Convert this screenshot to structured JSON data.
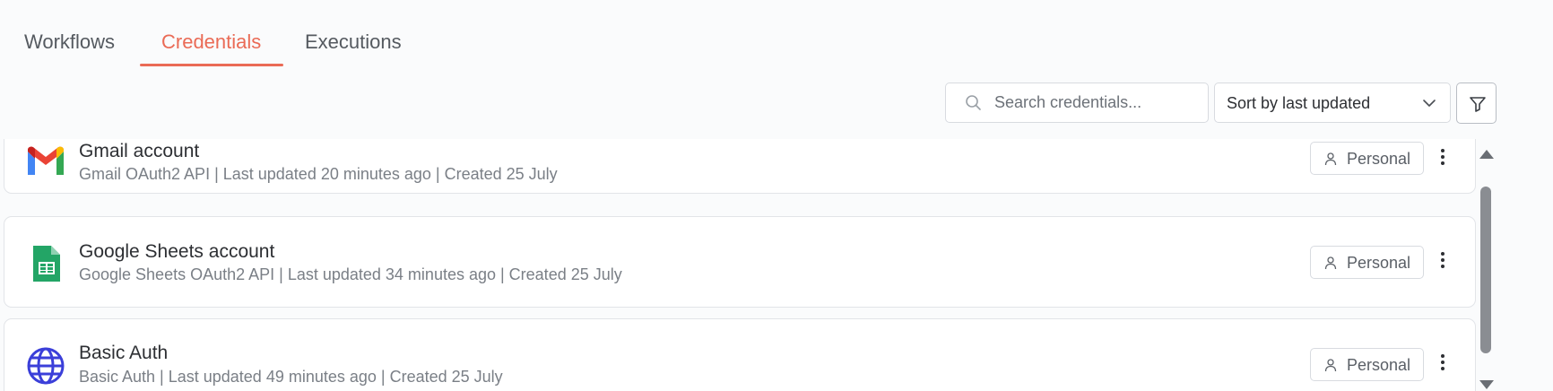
{
  "tabs": [
    {
      "label": "Workflows",
      "active": false
    },
    {
      "label": "Credentials",
      "active": true
    },
    {
      "label": "Executions",
      "active": false
    }
  ],
  "toolbar": {
    "search_placeholder": "Search credentials...",
    "search_value": "",
    "sort_selected": "Sort by last updated",
    "filter_icon": "filter-icon"
  },
  "credentials": [
    {
      "name": "Gmail account",
      "meta": "Gmail OAuth2 API | Last updated 20 minutes ago | Created 25 July",
      "icon": "gmail-icon",
      "badge": "Personal"
    },
    {
      "name": "Google Sheets account",
      "meta": "Google Sheets OAuth2 API | Last updated 34 minutes ago | Created 25 July",
      "icon": "google-sheets-icon",
      "badge": "Personal"
    },
    {
      "name": "Basic Auth",
      "meta": "Basic Auth | Last updated 49 minutes ago | Created 25 July",
      "icon": "globe-icon",
      "badge": "Personal"
    }
  ],
  "colors": {
    "accent": "#ea6b56",
    "text": "#2d2f33",
    "muted": "#7a7f86",
    "border": "#e2e4e8",
    "background": "#fafbfc"
  }
}
